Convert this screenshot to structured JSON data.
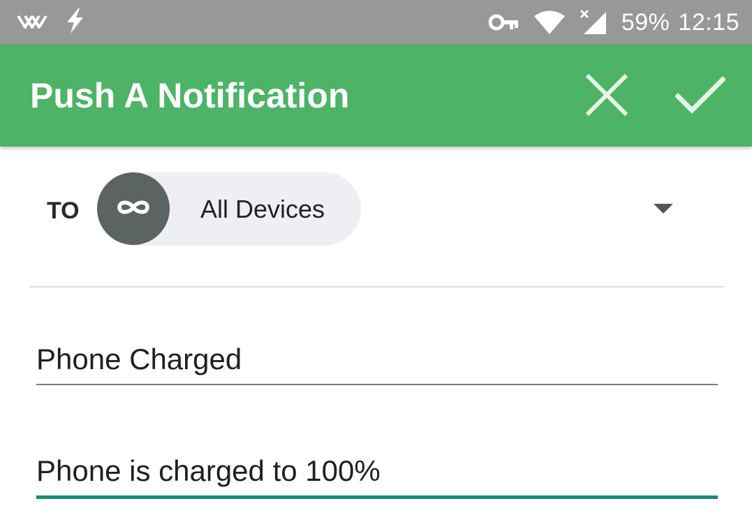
{
  "status_bar": {
    "icons_left": [
      "wifi-calling-icon",
      "flash-icon"
    ],
    "icons_right": [
      "vpn-key-icon",
      "wifi-icon",
      "cellular-no-service-icon"
    ],
    "battery": "59%",
    "time": "12:15"
  },
  "app_bar": {
    "title": "Push A Notification",
    "actions": [
      "close-icon",
      "check-icon"
    ],
    "color": "#4db366"
  },
  "form": {
    "to_label": "TO",
    "recipient": {
      "icon": "infinity-icon",
      "label": "All Devices"
    },
    "title_value": "Phone Charged",
    "message_value": "Phone is charged to 100%",
    "accent_color": "#1a8a74"
  }
}
